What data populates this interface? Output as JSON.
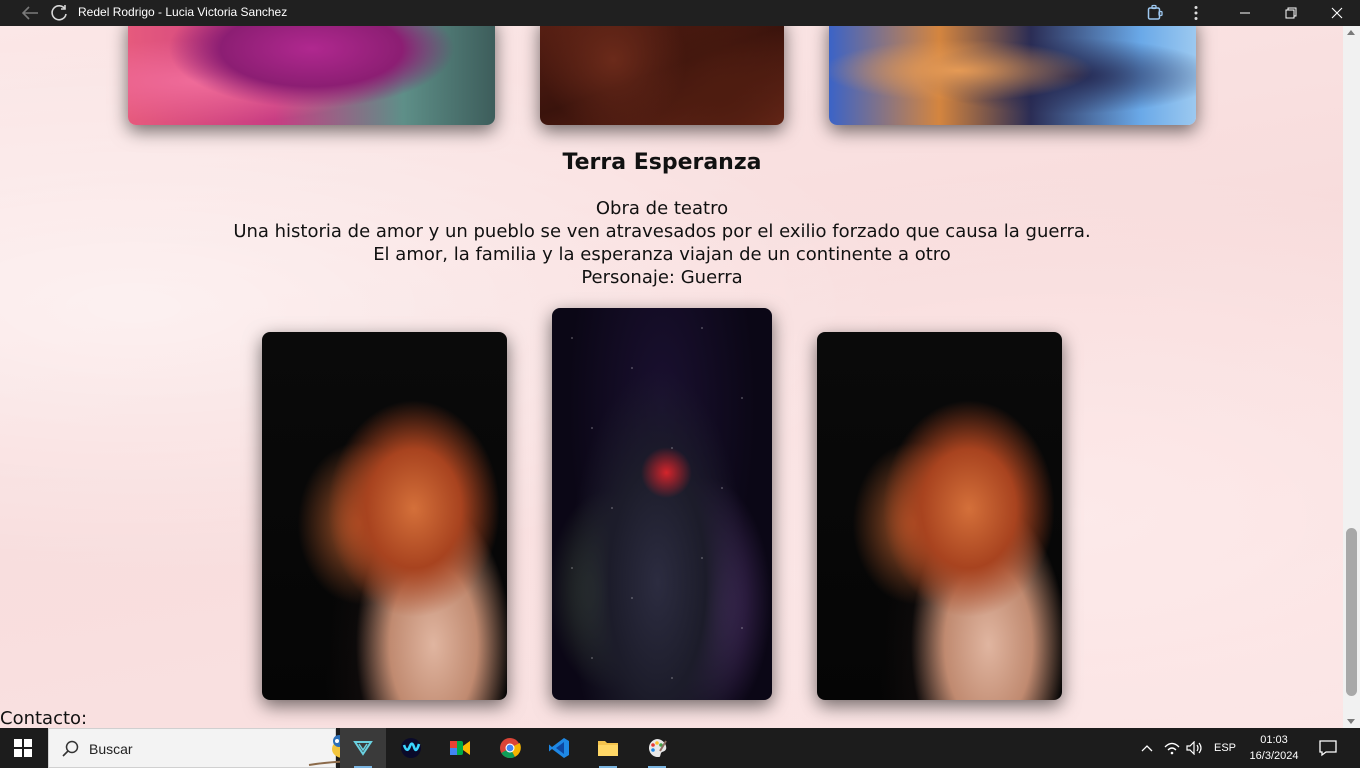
{
  "window": {
    "title": "Redel Rodrigo - Lucia Victoria Sanchez"
  },
  "content": {
    "heading": "Terra Esperanza",
    "description_lines": [
      "Obra de teatro",
      "Una historia de amor y un pueblo se ven atravesados por el exilio forzado que causa la guerra.",
      "El amor, la familia y la esperanza viajan de un continente a otro",
      "Personaje: Guerra"
    ],
    "contact_label": "Contacto:"
  },
  "taskbar": {
    "search_placeholder": "Buscar",
    "language": "ESP",
    "time": "01:03",
    "date": "16/3/2024",
    "apps": [
      "browser-app-icon",
      "webex-icon",
      "google-meet-icon",
      "chrome-icon",
      "vscode-icon",
      "file-explorer-icon",
      "paint-icon"
    ]
  },
  "colors": {
    "titlebar": "#202020",
    "taskbar": "#1c1c1c",
    "page_background": "#f7e2e2",
    "text": "#111111"
  }
}
